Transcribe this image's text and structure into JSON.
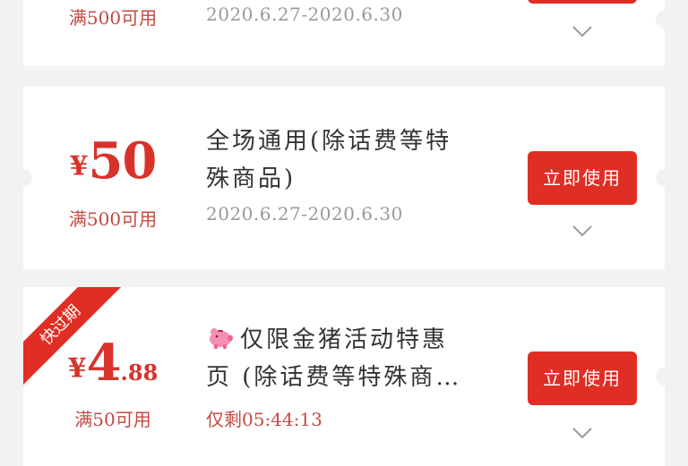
{
  "coupons": [
    {
      "currency": "¥",
      "amount_main": "",
      "amount_decimal": "",
      "condition": "满500可用",
      "validity": "2020.6.27-2020.6.30",
      "action_label": ""
    },
    {
      "currency": "¥",
      "amount_main": "50",
      "amount_decimal": "",
      "condition": "满500可用",
      "title_line1": "全场通用(除话费等特",
      "title_line2": "殊商品)",
      "validity": "2020.6.27-2020.6.30",
      "action_label": "立即使用"
    },
    {
      "ribbon": "快过期",
      "currency": "¥",
      "amount_main": "4",
      "amount_decimal": ".88",
      "condition": "满50可用",
      "title_line1": "仅限金猪活动特惠",
      "title_line2": "页 (除话费等特殊商…",
      "countdown": "仅剩05:44:13",
      "action_label": "立即使用"
    }
  ],
  "colors": {
    "accent": "#e02e24",
    "background": "#f2f2f2",
    "card": "#ffffff"
  },
  "icons": {
    "expand": "chevron-down-icon",
    "pig": "piggy-bank-icon"
  }
}
